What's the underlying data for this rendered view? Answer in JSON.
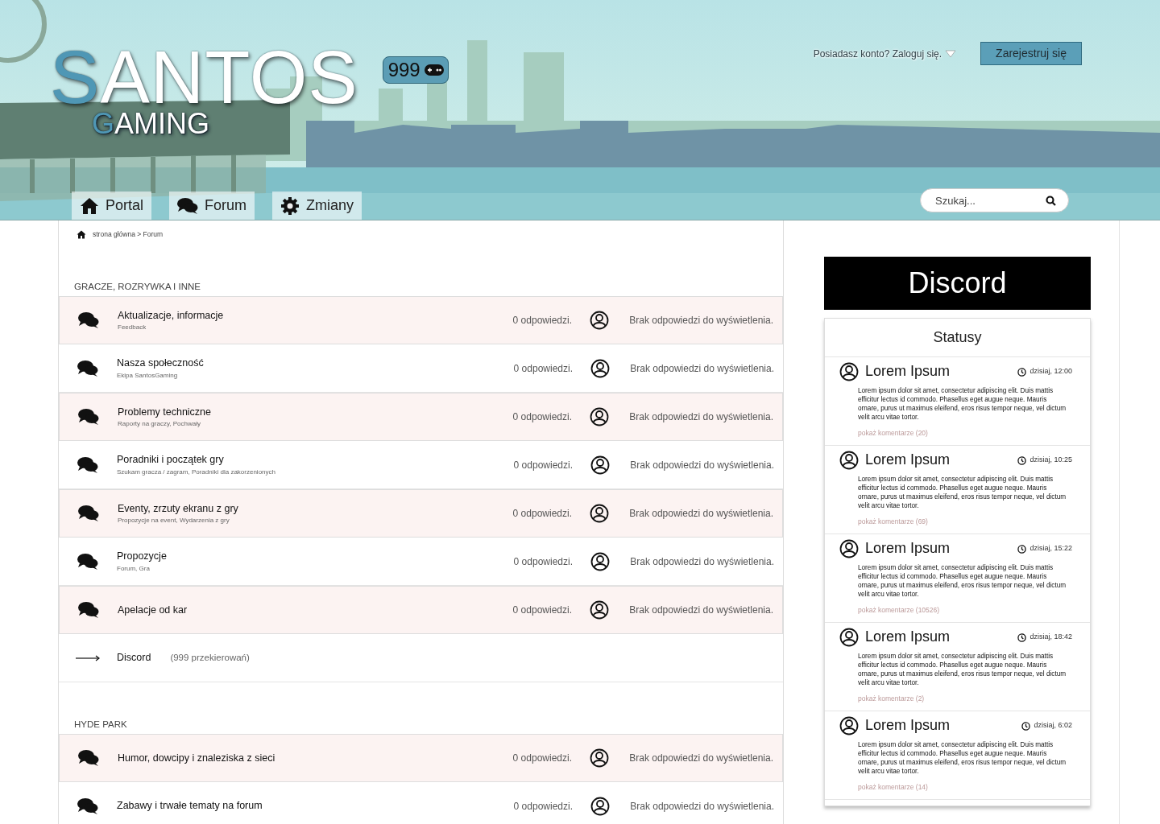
{
  "header": {
    "logo": {
      "title": "SANTOS",
      "subtitle": "GAMING"
    },
    "counter": "999",
    "login": "Posiadasz konto? Zaloguj się.",
    "register": "Zarejestruj się",
    "nav": [
      {
        "label": "Portal"
      },
      {
        "label": "Forum"
      },
      {
        "label": "Zmiany"
      }
    ],
    "search": {
      "placeholder": "Szukaj..."
    }
  },
  "breadcrumb": "strona główna > Forum",
  "sections": [
    {
      "title": "GRACZE, ROZRYWKA I INNE",
      "forums": [
        {
          "kind": "forum",
          "title": "Aktualizacje, informacje",
          "subtitle": "Feedback",
          "replies": "0 odpowiedzi.",
          "last_post": "Brak odpowiedzi do wyświetlenia."
        },
        {
          "kind": "forum",
          "title": "Nasza społeczność",
          "subtitle": "Ekipa SantosGaming",
          "replies": "0 odpowiedzi.",
          "last_post": "Brak odpowiedzi do wyświetlenia."
        },
        {
          "kind": "forum",
          "title": "Problemy techniczne",
          "subtitle": "Raporty na graczy, Pochwały",
          "replies": "0 odpowiedzi.",
          "last_post": "Brak odpowiedzi do wyświetlenia."
        },
        {
          "kind": "forum",
          "title": "Poradniki i początek gry",
          "subtitle": "Szukam gracza / zagram, Poradniki dla zakorzenionych",
          "replies": "0 odpowiedzi.",
          "last_post": "Brak odpowiedzi do wyświetlenia."
        },
        {
          "kind": "forum",
          "title": "Eventy, zrzuty ekranu z gry",
          "subtitle": "Propozycje na event, Wydarzenia z gry",
          "replies": "0 odpowiedzi.",
          "last_post": "Brak odpowiedzi do wyświetlenia."
        },
        {
          "kind": "forum",
          "title": "Propozycje",
          "subtitle": "Forum, Gra",
          "replies": "0 odpowiedzi.",
          "last_post": "Brak odpowiedzi do wyświetlenia."
        },
        {
          "kind": "forum",
          "title": "Apelacje od kar",
          "replies": "0 odpowiedzi.",
          "last_post": "Brak odpowiedzi do wyświetlenia."
        },
        {
          "kind": "redirect",
          "title": "Discord",
          "redirects": "(999 przekierowań)"
        }
      ]
    },
    {
      "title": "HYDE PARK",
      "forums": [
        {
          "kind": "forum",
          "title": "Humor, dowcipy i znaleziska z sieci",
          "replies": "0 odpowiedzi.",
          "last_post": "Brak odpowiedzi do wyświetlenia."
        },
        {
          "kind": "forum",
          "title": "Zabawy i trwałe tematy na forum",
          "replies": "0 odpowiedzi.",
          "last_post": "Brak odpowiedzi do wyświetlenia."
        }
      ]
    }
  ],
  "sidebar": {
    "discord": "Discord",
    "statuses": {
      "title": "Statusy",
      "posts": [
        {
          "author": "Lorem Ipsum",
          "time": "dzisiaj, 12:00",
          "text": "Lorem ipsum dolor sit amet, consectetur adipiscing elit. Duis mattis efficitur lectus id commodo. Phasellus eget augue neque. Mauris ornare, purus ut maximus eleifend, eros risus tempor neque, vel dictum velit arcu vitae tortor.",
          "comments": "pokaż komentarze (20)"
        },
        {
          "author": "Lorem Ipsum",
          "time": "dzisiaj, 10:25",
          "text": "Lorem ipsum dolor sit amet, consectetur adipiscing elit. Duis mattis efficitur lectus id commodo. Phasellus eget augue neque. Mauris ornare, purus ut maximus eleifend, eros risus tempor neque, vel dictum velit arcu vitae tortor.",
          "comments": "pokaż komentarze (69)"
        },
        {
          "author": "Lorem Ipsum",
          "time": "dzisiaj, 15:22",
          "text": "Lorem ipsum dolor sit amet, consectetur adipiscing elit. Duis mattis efficitur lectus id commodo. Phasellus eget augue neque. Mauris ornare, purus ut maximus eleifend, eros risus tempor neque, vel dictum velit arcu vitae tortor.",
          "comments": "pokaż komentarze (10526)"
        },
        {
          "author": "Lorem Ipsum",
          "time": "dzisiaj, 18:42",
          "text": "Lorem ipsum dolor sit amet, consectetur adipiscing elit. Duis mattis efficitur lectus id commodo. Phasellus eget augue neque. Mauris ornare, purus ut maximus eleifend, eros risus tempor neque, vel dictum velit arcu vitae tortor.",
          "comments": "pokaż komentarze (2)"
        },
        {
          "author": "Lorem Ipsum",
          "time": "dzisiaj, 6:02",
          "text": "Lorem ipsum dolor sit amet, consectetur adipiscing elit. Duis mattis efficitur lectus id commodo. Phasellus eget augue neque. Mauris ornare, purus ut maximus eleifend, eros risus tempor neque, vel dictum velit arcu vitae tortor.",
          "comments": "pokaż komentarze (14)"
        }
      ]
    }
  }
}
